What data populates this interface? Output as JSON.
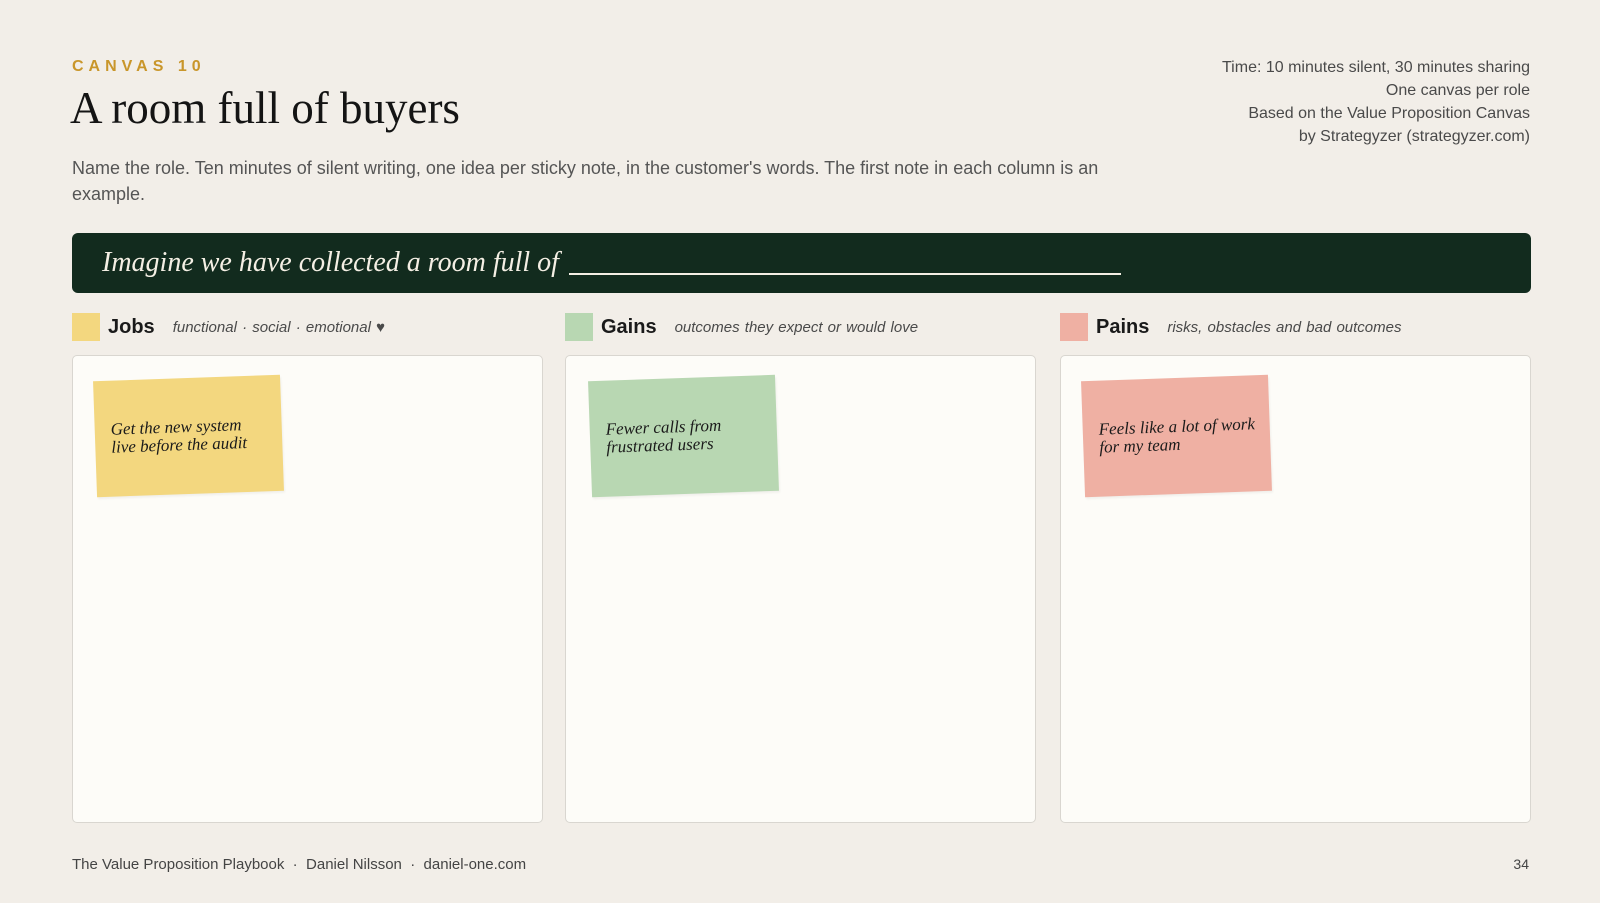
{
  "eyebrow": "CANVAS 10",
  "title": "A room full of buyers",
  "meta": [
    "Time: 10 minutes silent, 30 minutes sharing",
    "One canvas per role",
    "Based on the Value Proposition Canvas",
    "by Strategyzer (strategyzer.com)"
  ],
  "lede": "Name the role. Ten minutes of silent writing, one idea per sticky note, in the customer's words. The first note in each column is an example.",
  "banner": "Imagine we have collected a room full of",
  "columns": [
    {
      "name": "Jobs",
      "subtitle": "functional  ·  social  ·  emotional ♥",
      "color": "#f3d77f",
      "note": "Get the new system live before the audit"
    },
    {
      "name": "Gains",
      "subtitle": "outcomes they expect or would love",
      "color": "#b8d7b2",
      "note": "Fewer calls from frustrated users"
    },
    {
      "name": "Pains",
      "subtitle": "risks, obstacles and bad outcomes",
      "color": "#efb0a3",
      "note": "Feels like a lot of work for my team"
    }
  ],
  "footer": "The Value Proposition Playbook  ·  Daniel Nilsson  ·  daniel-one.com",
  "page_number": "34"
}
